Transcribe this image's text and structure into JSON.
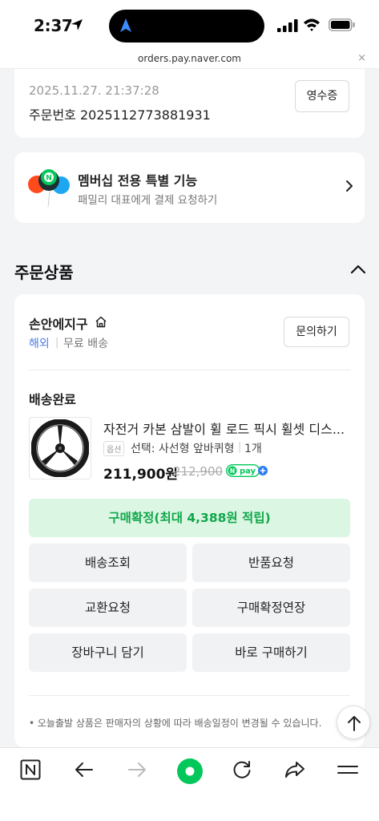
{
  "status_bar": {
    "time": "2:37"
  },
  "browser": {
    "url": "orders.pay.naver.com",
    "close_label": "×"
  },
  "order_info": {
    "datetime": "2025.11.27. 21:37:28",
    "order_number": "주문번호 2025112773881931",
    "receipt_label": "영수증"
  },
  "membership": {
    "title": "멤버십 전용 특별 기능",
    "subtitle": "패밀리 대표에게 결제 요청하기",
    "balloon_badge": "N"
  },
  "section": {
    "title": "주문상품"
  },
  "store": {
    "name": "손안에지구",
    "origin": "해외",
    "shipping": "무료 배송",
    "inquiry_label": "문의하기"
  },
  "product": {
    "status": "배송완료",
    "name": "자전거 카본 삼발이 휠 로드 픽시 휠셋 디스...",
    "option_badge": "옵션",
    "option": "선택: 사선형 앞바퀴형",
    "quantity": "1개",
    "price": "211,900원",
    "original_price": "212,900",
    "pay_badge": "pay"
  },
  "actions": {
    "confirm": "구매확정(최대 4,388원 적립)",
    "buttons": [
      "배송조회",
      "반품요청",
      "교환요청",
      "구매확정연장",
      "장바구니 담기",
      "바로 구매하기"
    ]
  },
  "notice": "• 오늘출발 상품은 판매자의 상황에 따라 배송일정이 변경될 수 있습니다.",
  "colors": {
    "naver_green": "#03c75a",
    "confirm_bg": "#dcf6e4",
    "confirm_text": "#11a74a",
    "link_blue": "#4a7de8"
  },
  "toolbar_icons": [
    "naver-n-icon",
    "back-arrow-icon",
    "forward-arrow-icon",
    "green-dot-icon",
    "reload-icon",
    "share-icon",
    "menu-icon"
  ]
}
